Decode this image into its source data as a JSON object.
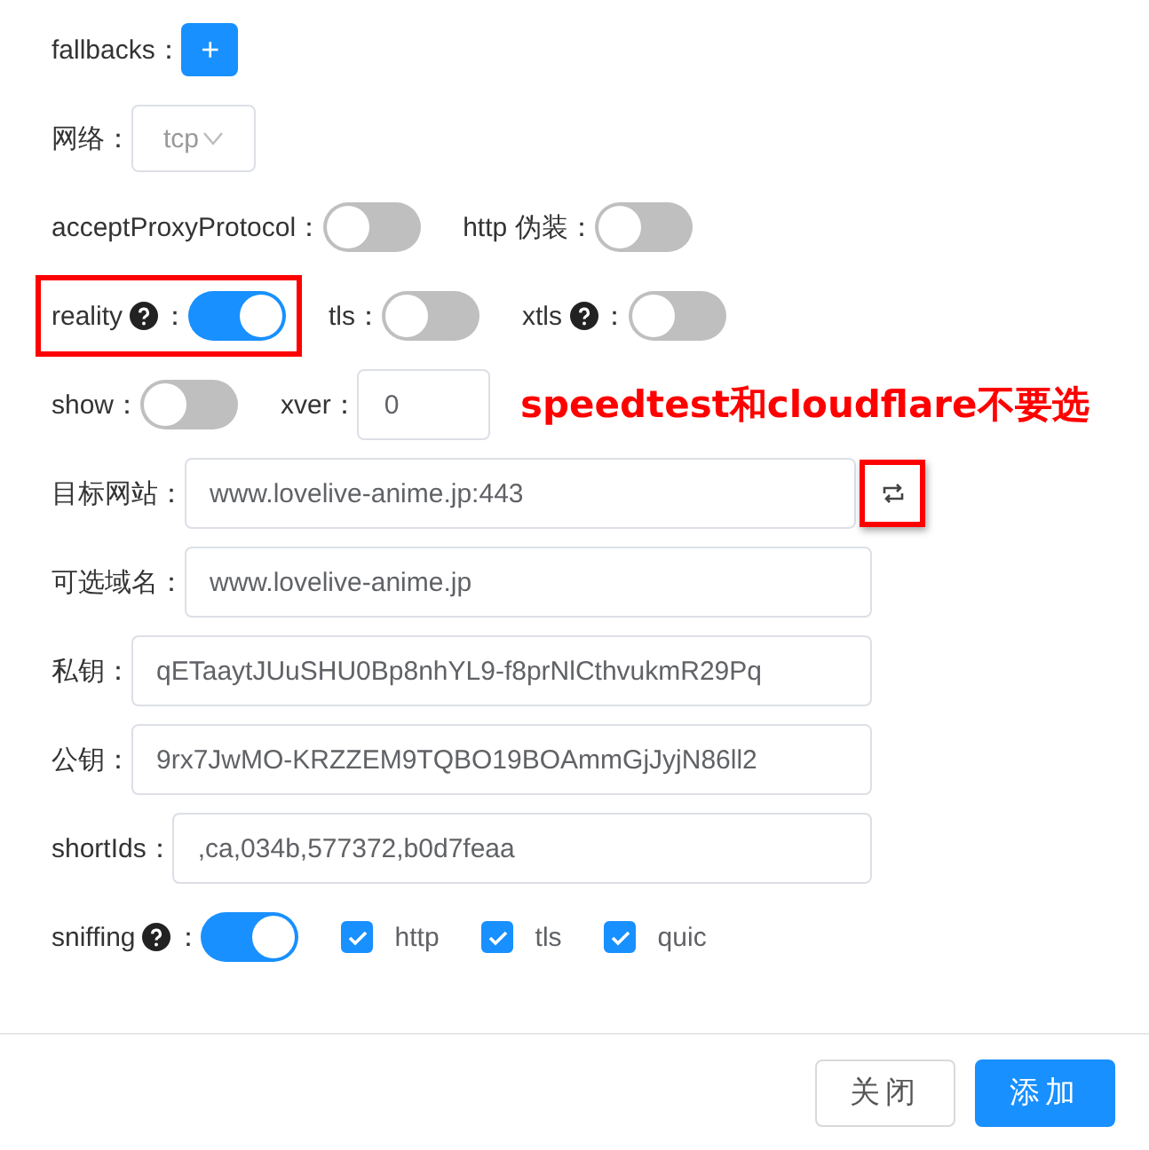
{
  "rows": [
    {
      "fields": [
        {
          "label": "fallbacks：",
          "control": {
            "kind": "add",
            "text": "+"
          }
        }
      ]
    },
    {
      "fields": [
        {
          "label": "网络：",
          "control": {
            "kind": "select",
            "value": "tcp"
          }
        }
      ]
    },
    {
      "fields": [
        {
          "label": "acceptProxyProtocol：",
          "control": {
            "kind": "switch",
            "on": false
          }
        },
        {
          "label": "http 伪装：",
          "control": {
            "kind": "switch",
            "on": false
          }
        }
      ]
    },
    {
      "fields": [
        {
          "label": "reality",
          "help": true,
          "suffix": "：",
          "highlighted": true,
          "control": {
            "kind": "switch",
            "on": true
          }
        },
        {
          "label": "tls：",
          "control": {
            "kind": "switch",
            "on": false
          }
        },
        {
          "label": "xtls",
          "help": true,
          "suffix": "：",
          "control": {
            "kind": "switch",
            "on": false
          }
        }
      ]
    },
    {
      "fields": [
        {
          "label": "show：",
          "control": {
            "kind": "switch",
            "on": false
          }
        },
        {
          "label": "xver：",
          "control": {
            "kind": "number",
            "value": "0"
          }
        }
      ],
      "note": "speedtest和cloudflare不要选"
    },
    {
      "fields": [
        {
          "label": "目标网站：",
          "control": {
            "kind": "input",
            "value": "www.lovelive-anime.jp:443",
            "action": {
              "highlighted": true
            }
          }
        }
      ]
    },
    {
      "fields": [
        {
          "label": "可选域名：",
          "control": {
            "kind": "input",
            "value": "www.lovelive-anime.jp"
          }
        }
      ]
    },
    {
      "fields": [
        {
          "label": "私钥：",
          "control": {
            "kind": "input",
            "value": "qETaaytJUuSHU0Bp8nhYL9-f8prNlCthvukmR29Pq"
          }
        }
      ]
    },
    {
      "fields": [
        {
          "label": "公钥：",
          "control": {
            "kind": "input",
            "value": "9rx7JwMO-KRZZEM9TQBO19BOAmmGjJyjN86ll2"
          }
        }
      ]
    },
    {
      "fields": [
        {
          "label": "shortIds：",
          "control": {
            "kind": "input",
            "value": ",ca,034b,577372,b0d7feaa"
          }
        }
      ]
    },
    {
      "fields": [
        {
          "label": "sniffing",
          "help": true,
          "suffix": "：",
          "control": {
            "kind": "switch",
            "on": true
          }
        },
        {
          "control": {
            "kind": "checkbox",
            "checked": true,
            "text": "http"
          }
        },
        {
          "control": {
            "kind": "checkbox",
            "checked": true,
            "text": "tls"
          }
        },
        {
          "control": {
            "kind": "checkbox",
            "checked": true,
            "text": "quic"
          }
        }
      ]
    }
  ],
  "footer": {
    "buttons": [
      {
        "text": "关闭",
        "primary": false
      },
      {
        "text": "添加",
        "primary": true
      }
    ]
  }
}
